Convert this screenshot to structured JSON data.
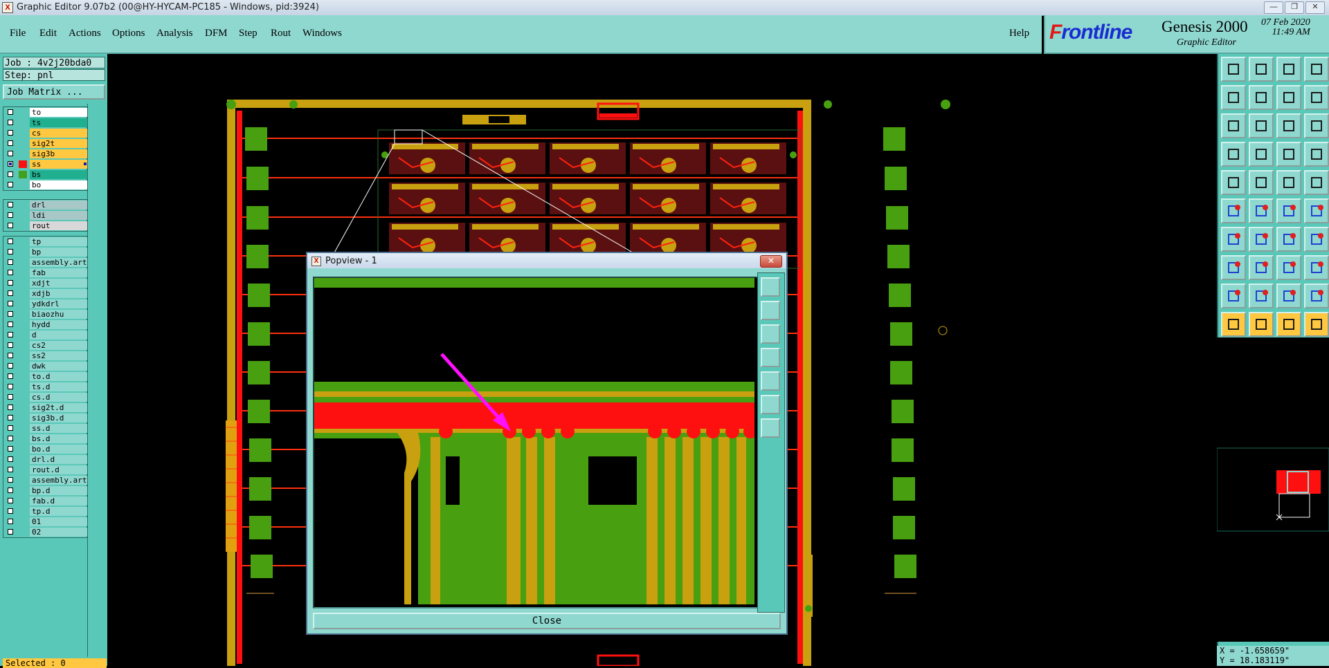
{
  "window": {
    "title": "Graphic Editor 9.07b2 (00@HY-HYCAM-PC185 - Windows, pid:3924)",
    "app_icon": "X",
    "controls": [
      "minimize-icon",
      "restore-icon",
      "close-icon"
    ]
  },
  "menu": {
    "items": [
      {
        "label": "File"
      },
      {
        "label": "Edit"
      },
      {
        "label": "Actions"
      },
      {
        "label": "Options"
      },
      {
        "label": "Analysis"
      },
      {
        "label": "DFM"
      },
      {
        "label": "Step"
      },
      {
        "label": "Rout"
      },
      {
        "label": "Windows"
      }
    ],
    "help": "Help"
  },
  "brand": {
    "logo_first": "F",
    "logo_rest": "rontline",
    "product": "Genesis 2000",
    "subtitle": "Graphic Editor",
    "date": "07 Feb 2020",
    "time": "11:49 AM"
  },
  "job": {
    "job_label": "Job : 4v2j20bda0",
    "step_label": "Step: pnl",
    "matrix_button": "Job Matrix ..."
  },
  "layer_groups": [
    [
      {
        "name": "to",
        "color": "#ffffff",
        "swatch": ""
      },
      {
        "name": "ts",
        "color": "#20b090",
        "swatch": ""
      },
      {
        "name": "cs",
        "color": "#ffc840",
        "swatch": ""
      },
      {
        "name": "sig2t",
        "color": "#ffc840",
        "swatch": ""
      },
      {
        "name": "sig3b",
        "color": "#ffc840",
        "swatch": ""
      },
      {
        "name": "ss",
        "color": "#ffc840",
        "swatch": "#ff1010",
        "checked": true,
        "active": true
      },
      {
        "name": "bs",
        "color": "#20b090",
        "swatch": "#40a020"
      },
      {
        "name": "bo",
        "color": "#ffffff",
        "swatch": ""
      }
    ],
    [
      {
        "name": "drl",
        "color": "#a8c8c8",
        "swatch": ""
      },
      {
        "name": "ldi",
        "color": "#a8c8c8",
        "swatch": ""
      },
      {
        "name": "rout",
        "color": "#d8d8d8",
        "swatch": ""
      }
    ],
    [
      {
        "name": "tp",
        "color": "#8fd8d0",
        "swatch": ""
      },
      {
        "name": "bp",
        "color": "#8fd8d0",
        "swatch": ""
      },
      {
        "name": "assembly.art",
        "color": "#8fd8d0",
        "swatch": ""
      },
      {
        "name": "fab",
        "color": "#8fd8d0",
        "swatch": ""
      },
      {
        "name": "xdjt",
        "color": "#8fd8d0",
        "swatch": ""
      },
      {
        "name": "xdjb",
        "color": "#8fd8d0",
        "swatch": ""
      },
      {
        "name": "ydkdrl",
        "color": "#8fd8d0",
        "swatch": ""
      },
      {
        "name": "biaozhu",
        "color": "#8fd8d0",
        "swatch": ""
      },
      {
        "name": "hydd",
        "color": "#8fd8d0",
        "swatch": ""
      },
      {
        "name": "d",
        "color": "#8fd8d0",
        "swatch": ""
      },
      {
        "name": "cs2",
        "color": "#8fd8d0",
        "swatch": ""
      },
      {
        "name": "ss2",
        "color": "#8fd8d0",
        "swatch": ""
      },
      {
        "name": "dwk",
        "color": "#8fd8d0",
        "swatch": ""
      },
      {
        "name": "to.d",
        "color": "#8fd8d0",
        "swatch": ""
      },
      {
        "name": "ts.d",
        "color": "#8fd8d0",
        "swatch": ""
      },
      {
        "name": "cs.d",
        "color": "#8fd8d0",
        "swatch": ""
      },
      {
        "name": "sig2t.d",
        "color": "#8fd8d0",
        "swatch": ""
      },
      {
        "name": "sig3b.d",
        "color": "#8fd8d0",
        "swatch": ""
      },
      {
        "name": "ss.d",
        "color": "#8fd8d0",
        "swatch": ""
      },
      {
        "name": "bs.d",
        "color": "#8fd8d0",
        "swatch": ""
      },
      {
        "name": "bo.d",
        "color": "#8fd8d0",
        "swatch": ""
      },
      {
        "name": "drl.d",
        "color": "#8fd8d0",
        "swatch": ""
      },
      {
        "name": "rout.d",
        "color": "#8fd8d0",
        "swatch": ""
      },
      {
        "name": "assembly.art",
        "color": "#8fd8d0",
        "swatch": ""
      },
      {
        "name": "bp.d",
        "color": "#8fd8d0",
        "swatch": ""
      },
      {
        "name": "fab.d",
        "color": "#8fd8d0",
        "swatch": ""
      },
      {
        "name": "tp.d",
        "color": "#8fd8d0",
        "swatch": ""
      },
      {
        "name": "01",
        "color": "#8fd8d0",
        "swatch": ""
      },
      {
        "name": "02",
        "color": "#8fd8d0",
        "swatch": ""
      }
    ]
  ],
  "status": {
    "selected": "Selected : 0",
    "x": "X = -1.658659\"",
    "y": "Y = 18.183119\""
  },
  "popview": {
    "title": "Popview - 1",
    "close_label": "Close"
  },
  "colors": {
    "panel_teal": "#5ac8b8",
    "menu_teal": "#8fd8d0",
    "copper_red": "#ff1010",
    "mask_green": "#48a010",
    "gold": "#c8a010",
    "annotation": "#ff10ff"
  },
  "toolbar_icons": [
    "page-up-icon",
    "page-down-icon",
    "home-icon",
    "split-icon",
    "pan-left-icon",
    "pan-right-icon",
    "mirror-icon",
    "redraw-icon",
    "fit-all-icon",
    "fit-center-icon",
    "ratio-icon",
    "help-icon",
    "snap-icon",
    "grid-icon",
    "layers-icon",
    "layers-alt-icon",
    "measure-icon",
    "line-icon",
    "ruler-icon",
    "pad-icon",
    "node-icon",
    "cross-icon",
    "move-icon",
    "copy-icon",
    "draw-line-icon",
    "slash-icon",
    "rotate-icon",
    "align-icon",
    "node-red-icon",
    "minus-icon",
    "resize-icon",
    "scale-icon",
    "triangle-icon",
    "text-a-icon",
    "text-a2-icon",
    "text-a3-icon",
    "pointer-icon",
    "pointer-red-icon",
    "pointer-multi-icon",
    "route-icon"
  ]
}
